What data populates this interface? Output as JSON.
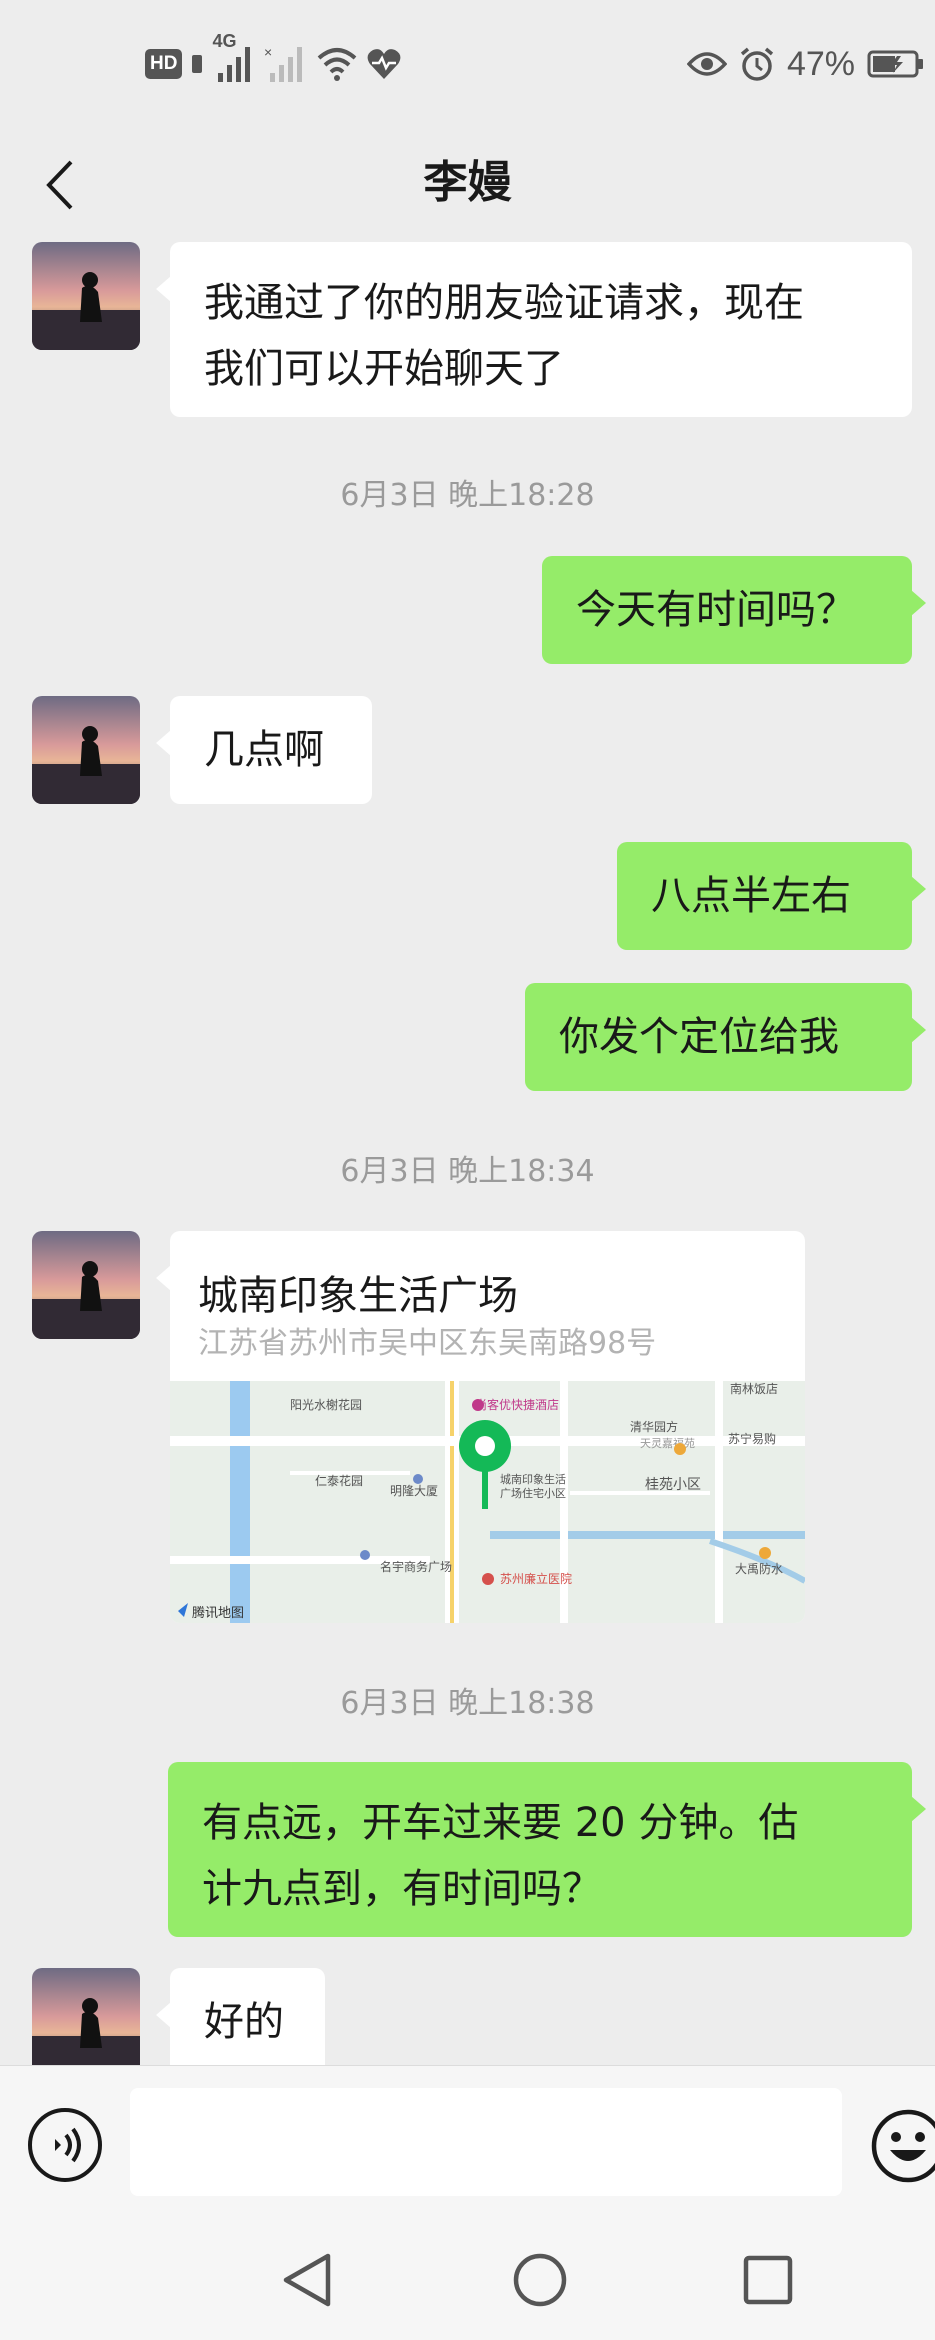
{
  "status_bar": {
    "hd_label": "HD",
    "network_label": "4G",
    "battery_percent": "47%",
    "icons": [
      "hd-icon",
      "signal-icon",
      "no-signal-icon",
      "wifi-icon",
      "heart-icon",
      "eye-icon",
      "alarm-icon",
      "battery-icon"
    ]
  },
  "header": {
    "title": "李嫚",
    "back_icon": "chevron-left-icon"
  },
  "messages": [
    {
      "side": "in",
      "text_lines": [
        "我通过了你的朋友验证请求，现在",
        "我们可以开始聊天了"
      ]
    },
    {
      "type": "time",
      "text": "6月3日 晚上18:28"
    },
    {
      "side": "out",
      "text": "今天有时间吗？"
    },
    {
      "side": "in",
      "text": "几点啊"
    },
    {
      "side": "out",
      "text": "八点半左右"
    },
    {
      "side": "out",
      "text": "你发个定位给我"
    },
    {
      "type": "time",
      "text": "6月3日 晚上18:34"
    },
    {
      "side": "in",
      "type": "location",
      "title": "城南印象生活广场",
      "address": "江苏省苏州市吴中区东吴南路98号",
      "map_labels": {
        "l1": "阳光水榭花园",
        "l2": "尚客优快捷酒店",
        "l3": "南林饭店",
        "l4": "清华园方",
        "l5": "天灵嘉福苑",
        "l6": "苏宁易购",
        "l7": "仁泰花园",
        "l8": "明隆大厦",
        "l9": "城南印象生活",
        "l10": "广场住宅小区",
        "l11": "桂苑小区",
        "l12": "名宇商务广场",
        "l13": "苏州廉立医院",
        "l14": "大禹防水",
        "l15": "腾讯地图"
      }
    },
    {
      "type": "time",
      "text": "6月3日 晚上18:38"
    },
    {
      "side": "out",
      "text_lines": [
        "有点远，开车过来要 20 分钟。估",
        "计九点到，有时间吗？"
      ]
    },
    {
      "side": "in",
      "text": "好的"
    }
  ],
  "input_bar": {
    "voice_icon": "voice-icon",
    "emoji_icon": "emoji-icon",
    "input_value": ""
  },
  "system_nav": {
    "back_icon": "triangle-back-icon",
    "home_icon": "circle-home-icon",
    "recents_icon": "square-recents-icon"
  },
  "colors": {
    "background": "#ededed",
    "incoming_bubble": "#ffffff",
    "outgoing_bubble": "#95ec69",
    "timestamp": "#9a9a9a"
  }
}
